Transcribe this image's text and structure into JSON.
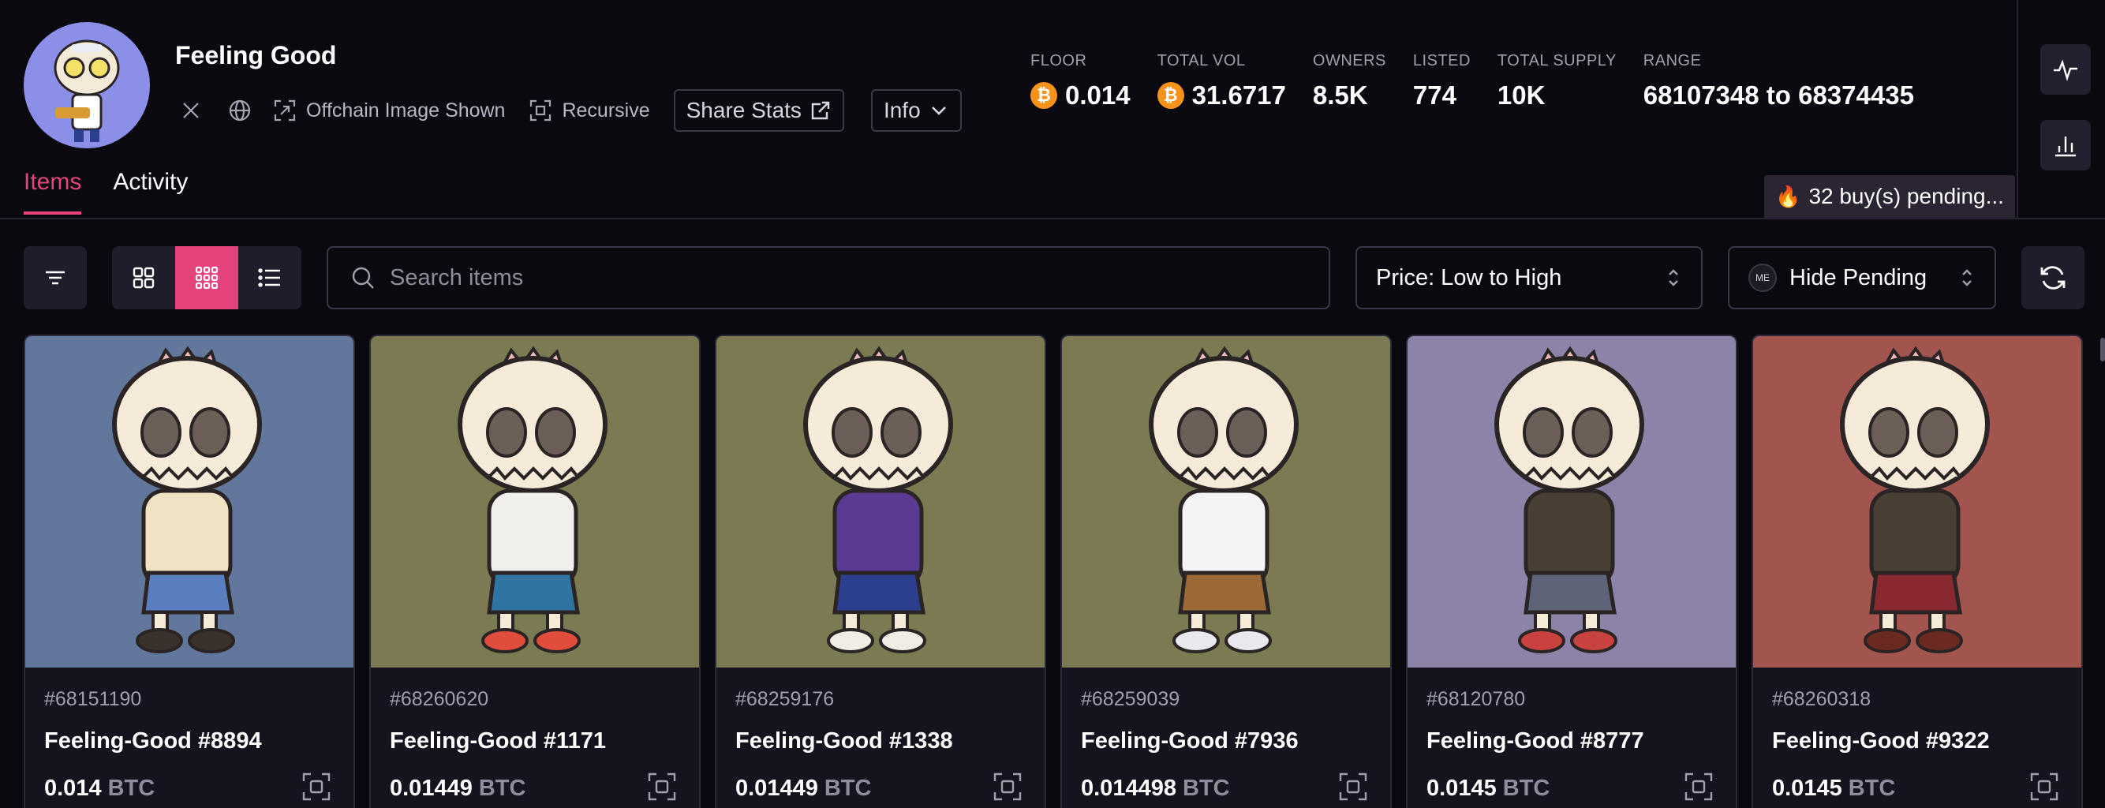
{
  "collection": {
    "name": "Feeling Good",
    "offchain_label": "Offchain Image Shown",
    "recursive_label": "Recursive",
    "share_label": "Share Stats",
    "info_label": "Info",
    "x_icon": "x-logo-icon",
    "globe_icon": "globe-icon"
  },
  "stats": [
    {
      "label": "FLOOR",
      "value": "0.014",
      "btc": true
    },
    {
      "label": "TOTAL VOL",
      "value": "31.6717",
      "btc": true
    },
    {
      "label": "OWNERS",
      "value": "8.5K",
      "btc": false
    },
    {
      "label": "LISTED",
      "value": "774",
      "btc": false
    },
    {
      "label": "TOTAL SUPPLY",
      "value": "10K",
      "btc": false
    },
    {
      "label": "RANGE",
      "value": "68107348 to 68374435",
      "btc": false
    }
  ],
  "tabs": {
    "items": "Items",
    "activity": "Activity"
  },
  "pending": {
    "icon": "🔥",
    "text": "32 buy(s) pending..."
  },
  "toolbar": {
    "search_placeholder": "Search items",
    "sort_label": "Price: Low to High",
    "pending_filter_label": "Hide Pending"
  },
  "colors": {
    "accent": "#e5437c",
    "btc": "#f7931a",
    "background": "#0b0910"
  },
  "cards": [
    {
      "id": "#68151190",
      "name": "Feeling-Good #8894",
      "price": "0.014",
      "unit": "BTC",
      "bg": "#61779b",
      "shirt": "#efe3c4",
      "pants": "#5a7fc1",
      "shoe": "#3a302c"
    },
    {
      "id": "#68260620",
      "name": "Feeling-Good #1171",
      "price": "0.01449",
      "unit": "BTC",
      "bg": "#7b7a52",
      "shirt": "#f2f0ec",
      "pants": "#2f74a3",
      "shoe": "#e04d3c"
    },
    {
      "id": "#68259176",
      "name": "Feeling-Good #1338",
      "price": "0.01449",
      "unit": "BTC",
      "bg": "#7b7a52",
      "shirt": "#5b3a93",
      "pants": "#2c3f8f",
      "shoe": "#f2ede4"
    },
    {
      "id": "#68259039",
      "name": "Feeling-Good #7936",
      "price": "0.014498",
      "unit": "BTC",
      "bg": "#7b7a52",
      "shirt": "#f4f4f7",
      "pants": "#9b6a36",
      "shoe": "#e8e8ee"
    },
    {
      "id": "#68120780",
      "name": "Feeling-Good #8777",
      "price": "0.0145",
      "unit": "BTC",
      "bg": "#8d83a8",
      "shirt": "#4a3f35",
      "pants": "#5e6478",
      "shoe": "#c8423f"
    },
    {
      "id": "#68260318",
      "name": "Feeling-Good #9322",
      "price": "0.0145",
      "unit": "BTC",
      "bg": "#a2544f",
      "shirt": "#4a3f35",
      "pants": "#8a2832",
      "shoe": "#6a2a22"
    }
  ]
}
